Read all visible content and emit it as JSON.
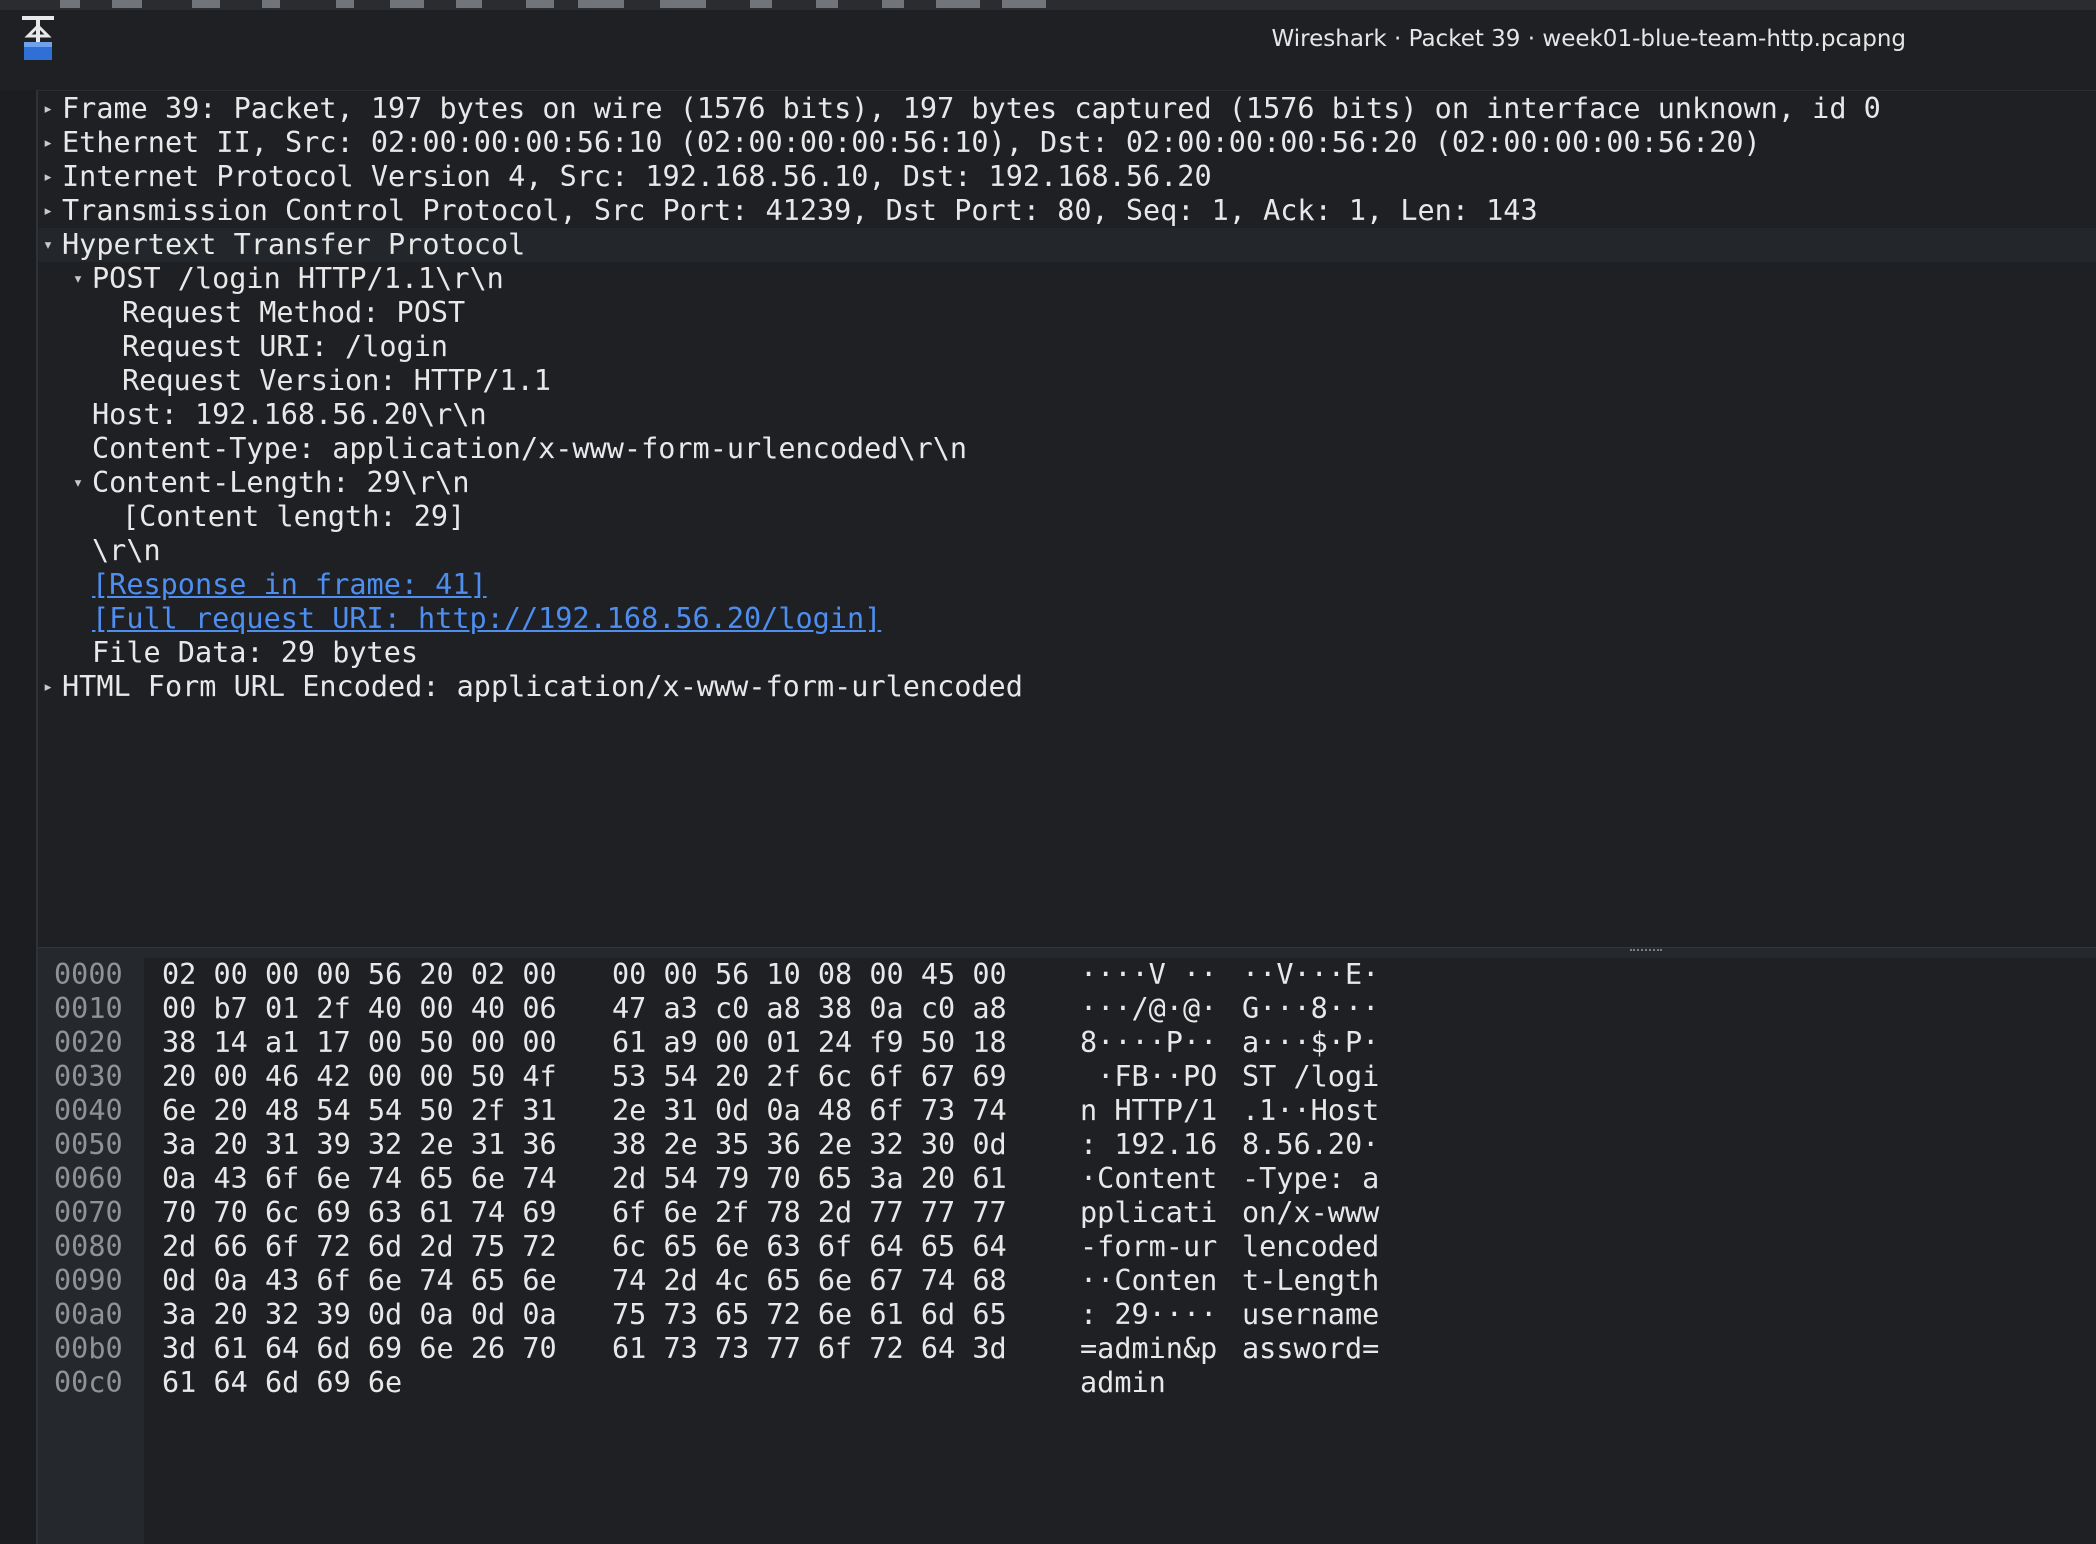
{
  "window": {
    "title": "Wireshark · Packet 39 · week01-blue-team-http.pcapng"
  },
  "details": {
    "rows": [
      {
        "text": "Frame 39: Packet, 197 bytes on wire (1576 bits), 197 bytes captured (1576 bits) on interface unknown, id 0",
        "expander": "collapsed"
      },
      {
        "text": "Ethernet II, Src: 02:00:00:00:56:10 (02:00:00:00:56:10), Dst: 02:00:00:00:56:20 (02:00:00:00:56:20)",
        "expander": "collapsed"
      },
      {
        "text": "Internet Protocol Version 4, Src: 192.168.56.10, Dst: 192.168.56.20",
        "expander": "collapsed"
      },
      {
        "text": "Transmission Control Protocol, Src Port: 41239, Dst Port: 80, Seq: 1, Ack: 1, Len: 143",
        "expander": "collapsed"
      },
      {
        "text": "Hypertext Transfer Protocol",
        "expander": "expanded"
      },
      {
        "text": "POST /login HTTP/1.1\\r\\n",
        "expander": "expanded"
      },
      {
        "text": "Request Method: POST",
        "expander": "none"
      },
      {
        "text": "Request URI: /login",
        "expander": "none"
      },
      {
        "text": "Request Version: HTTP/1.1",
        "expander": "none"
      },
      {
        "text": "Host: 192.168.56.20\\r\\n",
        "expander": "none"
      },
      {
        "text": "Content-Type: application/x-www-form-urlencoded\\r\\n",
        "expander": "none"
      },
      {
        "text": "Content-Length: 29\\r\\n",
        "expander": "expanded"
      },
      {
        "text": "[Content length: 29]",
        "expander": "none"
      },
      {
        "text": "\\r\\n",
        "expander": "none"
      },
      {
        "text": "[Response in frame: 41]",
        "expander": "none",
        "link": true
      },
      {
        "text": "[Full request URI: http://192.168.56.20/login]",
        "expander": "none",
        "link": true
      },
      {
        "text": "File Data: 29 bytes",
        "expander": "none"
      },
      {
        "text": "HTML Form URL Encoded: application/x-www-form-urlencoded",
        "expander": "collapsed"
      }
    ]
  },
  "bytes": {
    "rows": [
      {
        "offset": "0000",
        "hex1": "02 00 00 00 56 20 02 00",
        "hex2": "00 00 56 10 08 00 45 00",
        "ascii1": "····V ··",
        "ascii2": "··V···E·"
      },
      {
        "offset": "0010",
        "hex1": "00 b7 01 2f 40 00 40 06",
        "hex2": "47 a3 c0 a8 38 0a c0 a8",
        "ascii1": "···/@·@·",
        "ascii2": "G···8···"
      },
      {
        "offset": "0020",
        "hex1": "38 14 a1 17 00 50 00 00",
        "hex2": "61 a9 00 01 24 f9 50 18",
        "ascii1": "8····P··",
        "ascii2": "a···$·P·"
      },
      {
        "offset": "0030",
        "hex1": "20 00 46 42 00 00 50 4f",
        "hex2": "53 54 20 2f 6c 6f 67 69",
        "ascii1": " ·FB··PO",
        "ascii2": "ST /logi"
      },
      {
        "offset": "0040",
        "hex1": "6e 20 48 54 54 50 2f 31",
        "hex2": "2e 31 0d 0a 48 6f 73 74",
        "ascii1": "n HTTP/1",
        "ascii2": ".1··Host"
      },
      {
        "offset": "0050",
        "hex1": "3a 20 31 39 32 2e 31 36",
        "hex2": "38 2e 35 36 2e 32 30 0d",
        "ascii1": ": 192.16",
        "ascii2": "8.56.20·"
      },
      {
        "offset": "0060",
        "hex1": "0a 43 6f 6e 74 65 6e 74",
        "hex2": "2d 54 79 70 65 3a 20 61",
        "ascii1": "·Content",
        "ascii2": "-Type: a"
      },
      {
        "offset": "0070",
        "hex1": "70 70 6c 69 63 61 74 69",
        "hex2": "6f 6e 2f 78 2d 77 77 77",
        "ascii1": "pplicati",
        "ascii2": "on/x-www"
      },
      {
        "offset": "0080",
        "hex1": "2d 66 6f 72 6d 2d 75 72",
        "hex2": "6c 65 6e 63 6f 64 65 64",
        "ascii1": "-form-ur",
        "ascii2": "lencoded"
      },
      {
        "offset": "0090",
        "hex1": "0d 0a 43 6f 6e 74 65 6e",
        "hex2": "74 2d 4c 65 6e 67 74 68",
        "ascii1": "··Conten",
        "ascii2": "t-Length"
      },
      {
        "offset": "00a0",
        "hex1": "3a 20 32 39 0d 0a 0d 0a",
        "hex2": "75 73 65 72 6e 61 6d 65",
        "ascii1": ": 29····",
        "ascii2": "username"
      },
      {
        "offset": "00b0",
        "hex1": "3d 61 64 6d 69 6e 26 70",
        "hex2": "61 73 73 77 6f 72 64 3d",
        "ascii1": "=admin&p",
        "ascii2": "assword="
      },
      {
        "offset": "00c0",
        "hex1": "61 64 6d 69 6e",
        "hex2": "",
        "ascii1": "admin",
        "ascii2": ""
      }
    ]
  },
  "colors": {
    "background": "#1e2024",
    "text": "#e8e8e8",
    "link": "#4d8ef0",
    "offset_text": "#8f9297"
  }
}
